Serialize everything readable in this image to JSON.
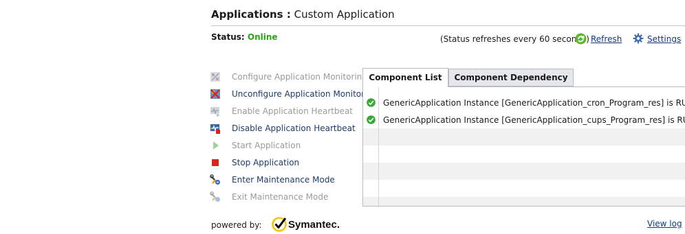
{
  "header": {
    "title_strong": "Applications :",
    "title_rest": "Custom Application"
  },
  "status": {
    "label": "Status:",
    "value": "Online",
    "refresh_note": "(Status refreshes every 60 seconds)",
    "refresh_label": "Refresh",
    "settings_label": "Settings"
  },
  "actions": [
    {
      "label": "Configure Application Monitoring",
      "enabled": false,
      "icon": "configure-icon"
    },
    {
      "label": "Unconfigure Application Monitoring",
      "enabled": true,
      "icon": "unconfigure-icon"
    },
    {
      "label": "Enable Application Heartbeat",
      "enabled": false,
      "icon": "heartbeat-enable-icon"
    },
    {
      "label": "Disable Application Heartbeat",
      "enabled": true,
      "icon": "heartbeat-disable-icon"
    },
    {
      "label": "Start Application",
      "enabled": false,
      "icon": "play-icon"
    },
    {
      "label": "Stop Application",
      "enabled": true,
      "icon": "stop-icon"
    },
    {
      "label": "Enter Maintenance Mode",
      "enabled": true,
      "icon": "maintenance-enter-icon"
    },
    {
      "label": "Exit Maintenance Mode",
      "enabled": false,
      "icon": "maintenance-exit-icon"
    }
  ],
  "tabs": [
    {
      "label": "Component List",
      "active": true
    },
    {
      "label": "Component Dependency",
      "active": false
    }
  ],
  "components": [
    {
      "text": "GenericApplication Instance [GenericApplication_cron_Program_res] is RUNNING",
      "status": "ok"
    },
    {
      "text": "GenericApplication Instance [GenericApplication_cups_Program_res] is RUNNING",
      "status": "ok"
    }
  ],
  "footer": {
    "powered_by": "powered by:",
    "brand": "Symantec.",
    "view_log": "View log"
  },
  "colors": {
    "online": "#2ea31a",
    "link": "#123a78",
    "disabled_text": "#9a9a9a",
    "brand_yellow": "#f5c400"
  }
}
